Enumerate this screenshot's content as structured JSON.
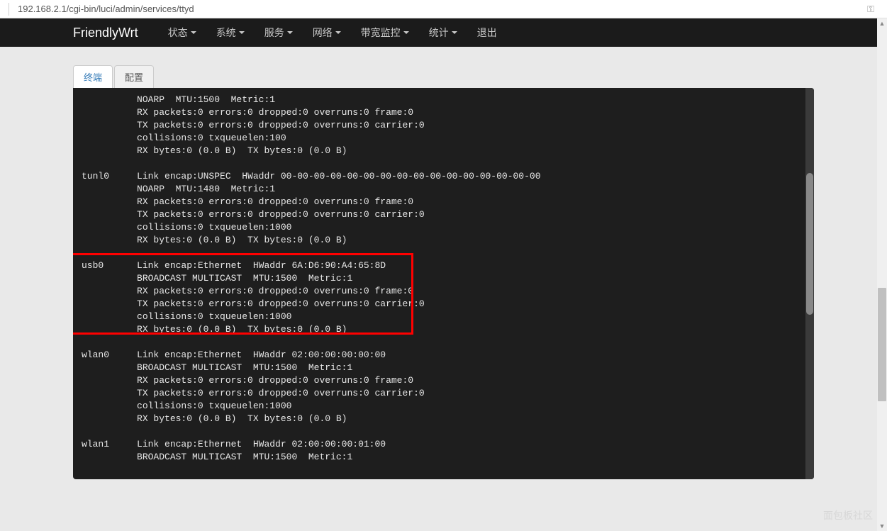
{
  "address_bar": {
    "url": "192.168.2.1/cgi-bin/luci/admin/services/ttyd"
  },
  "header": {
    "brand": "FriendlyWrt",
    "nav": [
      {
        "label": "状态",
        "dropdown": true
      },
      {
        "label": "系统",
        "dropdown": true
      },
      {
        "label": "服务",
        "dropdown": true
      },
      {
        "label": "网络",
        "dropdown": true
      },
      {
        "label": "带宽监控",
        "dropdown": true
      },
      {
        "label": "统计",
        "dropdown": true
      },
      {
        "label": "退出",
        "dropdown": false
      }
    ]
  },
  "tabs": [
    {
      "label": "终端",
      "active": true
    },
    {
      "label": "配置",
      "active": false
    }
  ],
  "terminal": {
    "blocks": [
      {
        "iface": "",
        "lines": [
          "NOARP  MTU:1500  Metric:1",
          "RX packets:0 errors:0 dropped:0 overruns:0 frame:0",
          "TX packets:0 errors:0 dropped:0 overruns:0 carrier:0",
          "collisions:0 txqueuelen:100",
          "RX bytes:0 (0.0 B)  TX bytes:0 (0.0 B)"
        ]
      },
      {
        "iface": "tunl0",
        "lines": [
          "Link encap:UNSPEC  HWaddr 00-00-00-00-00-00-00-00-00-00-00-00-00-00-00-00",
          "NOARP  MTU:1480  Metric:1",
          "RX packets:0 errors:0 dropped:0 overruns:0 frame:0",
          "TX packets:0 errors:0 dropped:0 overruns:0 carrier:0",
          "collisions:0 txqueuelen:1000",
          "RX bytes:0 (0.0 B)  TX bytes:0 (0.0 B)"
        ]
      },
      {
        "iface": "usb0",
        "highlighted": true,
        "lines": [
          "Link encap:Ethernet  HWaddr 6A:D6:90:A4:65:8D",
          "BROADCAST MULTICAST  MTU:1500  Metric:1",
          "RX packets:0 errors:0 dropped:0 overruns:0 frame:0",
          "TX packets:0 errors:0 dropped:0 overruns:0 carrier:0",
          "collisions:0 txqueuelen:1000",
          "RX bytes:0 (0.0 B)  TX bytes:0 (0.0 B)"
        ]
      },
      {
        "iface": "wlan0",
        "lines": [
          "Link encap:Ethernet  HWaddr 02:00:00:00:00:00",
          "BROADCAST MULTICAST  MTU:1500  Metric:1",
          "RX packets:0 errors:0 dropped:0 overruns:0 frame:0",
          "TX packets:0 errors:0 dropped:0 overruns:0 carrier:0",
          "collisions:0 txqueuelen:1000",
          "RX bytes:0 (0.0 B)  TX bytes:0 (0.0 B)"
        ]
      },
      {
        "iface": "wlan1",
        "lines": [
          "Link encap:Ethernet  HWaddr 02:00:00:00:01:00",
          "BROADCAST MULTICAST  MTU:1500  Metric:1"
        ]
      }
    ]
  },
  "watermark": "面包板社区"
}
